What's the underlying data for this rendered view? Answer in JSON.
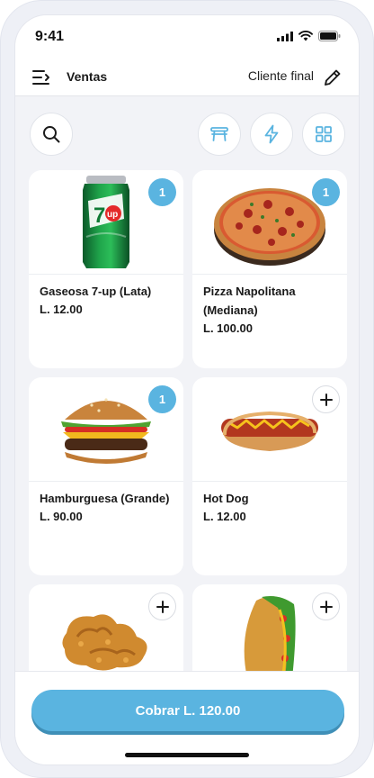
{
  "status_bar": {
    "time": "9:41"
  },
  "header": {
    "title": "Ventas",
    "client": "Cliente final"
  },
  "toolbar": {
    "icons": [
      "search-icon",
      "table-icon",
      "lightning-icon",
      "grid-icon"
    ]
  },
  "products": [
    {
      "name": "Gaseosa 7-up (Lata)",
      "price": "L. 12.00",
      "quantity": "1"
    },
    {
      "name": "Pizza Napolitana (Mediana)",
      "price": "L. 100.00",
      "quantity": "1"
    },
    {
      "name": "Hamburguesa (Grande)",
      "price": "L. 90.00",
      "quantity": "1"
    },
    {
      "name": "Hot Dog",
      "price": "L. 12.00",
      "quantity": null
    },
    {
      "name": "",
      "price": "",
      "quantity": null
    },
    {
      "name": "",
      "price": "",
      "quantity": null
    }
  ],
  "footer": {
    "checkout_label": "Cobrar L. 120.00"
  },
  "colors": {
    "accent": "#5ab4e0",
    "background": "#f2f3f7",
    "card": "#ffffff"
  }
}
